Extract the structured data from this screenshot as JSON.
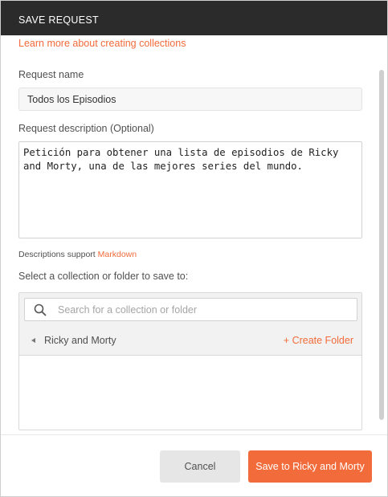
{
  "modal": {
    "title": "SAVE REQUEST"
  },
  "form": {
    "learn_more_link": "Learn more about creating collections",
    "request_name_label": "Request name",
    "request_name_value": "Todos los Episodios",
    "description_label": "Request description (Optional)",
    "description_value": "Petición para obtener una lista de episodios de Ricky and Morty, una de las mejores series del mundo.",
    "markdown_hint_prefix": "Descriptions support",
    "markdown_link": "Markdown",
    "collection_label": "Select a collection or folder to save to:"
  },
  "collection_picker": {
    "search_placeholder": "Search for a collection or folder",
    "search_icon": "search-icon",
    "current_collection": "Ricky and Morty",
    "back_icon": "caret-left-icon",
    "create_folder_label": "+ Create Folder"
  },
  "footer": {
    "cancel_label": "Cancel",
    "save_label": "Save to Ricky and Morty"
  },
  "colors": {
    "accent": "#f26b3a",
    "header_bg": "#2b2b2b",
    "cancel_bg": "#e6e6e6"
  }
}
